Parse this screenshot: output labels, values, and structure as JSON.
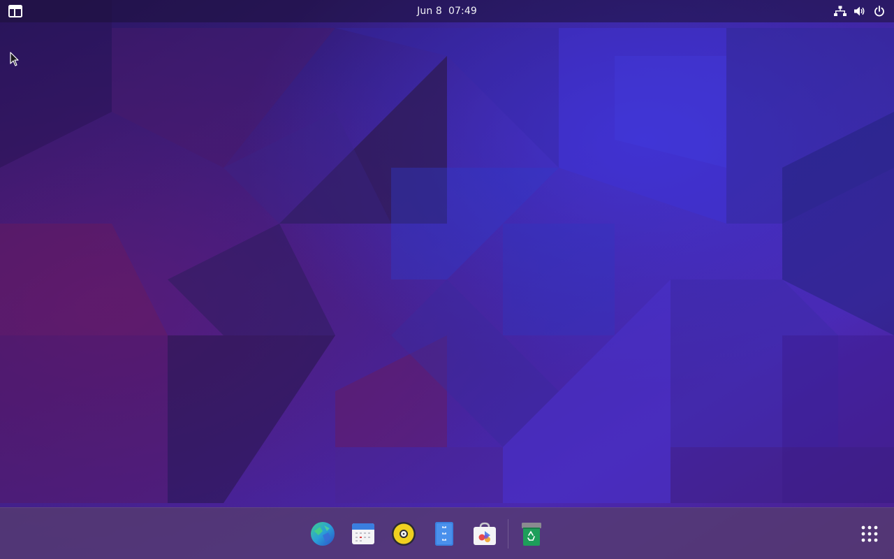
{
  "topbar": {
    "clock": "Jun 8  07:49",
    "activities_icon": "activities-layout-icon",
    "tray": {
      "network_icon": "network-icon",
      "volume_icon": "volume-icon",
      "power_icon": "power-icon"
    }
  },
  "dock": {
    "apps": [
      {
        "icon": "web-browser-icon"
      },
      {
        "icon": "calendar-icon"
      },
      {
        "icon": "music-player-icon"
      },
      {
        "icon": "file-manager-icon"
      },
      {
        "icon": "software-center-icon"
      }
    ],
    "trash_icon": "trash-icon",
    "show_apps_icon": "app-grid-icon"
  },
  "colors": {
    "wallpaper_dark": "#2a1858",
    "wallpaper_violet": "#4b2596",
    "wallpaper_blue": "#3a36d6",
    "wallpaper_magenta": "#5a1a6e",
    "dock_bg": "#563c6e",
    "text": "#f2f2f7"
  }
}
